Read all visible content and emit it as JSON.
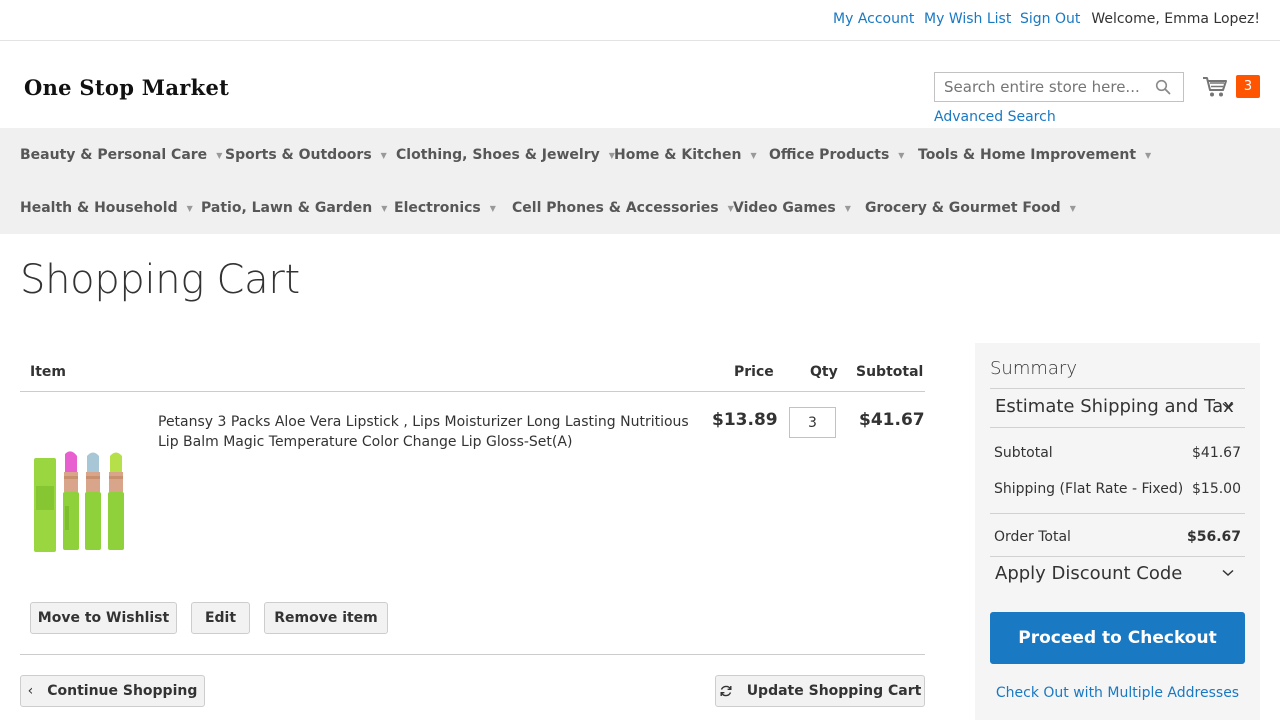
{
  "top_links": {
    "my_account": "My Account",
    "my_wish_list": "My Wish List",
    "sign_out": "Sign Out",
    "welcome": "Welcome, Emma Lopez!"
  },
  "header": {
    "logo": "One Stop Market",
    "search_placeholder": "Search entire store here...",
    "advanced_search": "Advanced Search",
    "cart_count": "3",
    "cart_badge_color": "#ff5501"
  },
  "nav": {
    "row1": [
      "Beauty & Personal Care",
      "Sports & Outdoors",
      "Clothing, Shoes & Jewelry",
      "Home & Kitchen",
      "Office Products",
      "Tools & Home Improvement"
    ],
    "row2": [
      "Health & Household",
      "Patio, Lawn & Garden",
      "Electronics",
      "Cell Phones & Accessories",
      "Video Games",
      "Grocery & Gourmet Food"
    ]
  },
  "page_title": "Shopping Cart",
  "cart_table": {
    "headers": {
      "item": "Item",
      "price": "Price",
      "qty": "Qty",
      "subtotal": "Subtotal"
    },
    "items": [
      {
        "name": "Petansy 3 Packs Aloe Vera Lipstick , Lips Moisturizer Long Lasting Nutritious Lip Balm Magic Temperature Color Change Lip Gloss-Set(A)",
        "price": "$13.89",
        "qty": "3",
        "subtotal": "$41.67"
      }
    ],
    "item_actions": {
      "move_to_wishlist": "Move to Wishlist",
      "edit": "Edit",
      "remove": "Remove item"
    },
    "continue_shopping": "Continue Shopping",
    "update_cart": "Update Shopping Cart"
  },
  "summary": {
    "title": "Summary",
    "estimate_shipping": "Estimate Shipping and Tax",
    "subtotal_label": "Subtotal",
    "subtotal_value": "$41.67",
    "shipping_label": "Shipping (Flat Rate - Fixed)",
    "shipping_value": "$15.00",
    "order_total_label": "Order Total",
    "order_total_value": "$56.67",
    "apply_discount": "Apply Discount Code",
    "checkout_button": "Proceed to Checkout",
    "multi_address": "Check Out with Multiple Addresses",
    "accent_color": "#1979c3"
  }
}
